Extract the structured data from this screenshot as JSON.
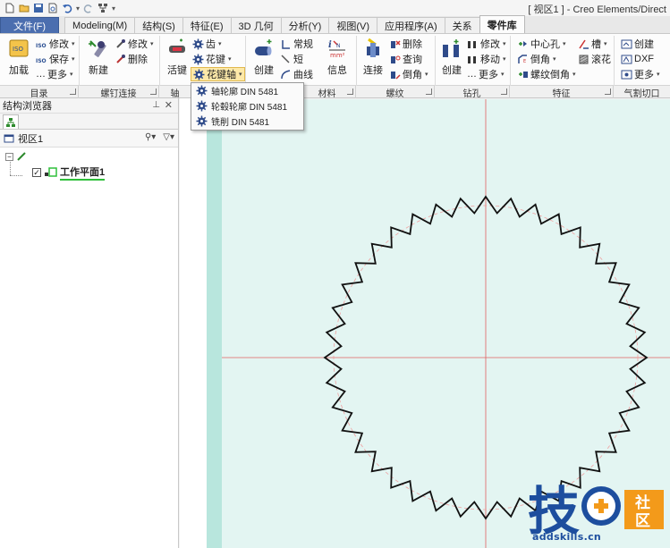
{
  "window": {
    "title": "[ 视区1 ] - Creo Elements/Direct"
  },
  "tabs": [
    {
      "label": "文件(F)"
    },
    {
      "label": "Modeling(M)"
    },
    {
      "label": "结构(S)"
    },
    {
      "label": "特征(E)"
    },
    {
      "label": "3D 几何"
    },
    {
      "label": "分析(Y)"
    },
    {
      "label": "视图(V)"
    },
    {
      "label": "应用程序(A)"
    },
    {
      "label": "关系"
    },
    {
      "label": "零件库"
    }
  ],
  "ribbon": {
    "catalog": {
      "load": "加载",
      "modify": "修改",
      "save": "保存",
      "more": "更多",
      "group": "目录"
    },
    "screw": {
      "new": "新建",
      "modify": "修改",
      "delete": "删除",
      "group": "螺钉连接"
    },
    "shaft": {
      "key": "活键",
      "gear": "齿",
      "spline": "花键",
      "spline_shaft": "花键轴",
      "group": "轴"
    },
    "material": {
      "create": "创建",
      "normal": "常规",
      "short": "短",
      "curve": "曲线",
      "info": "信息",
      "group": "材料"
    },
    "thread": {
      "connect": "连接",
      "delete": "删除",
      "query": "查询",
      "chamfer": "倒角",
      "group": "螺纹"
    },
    "drill": {
      "create": "创建",
      "modify": "修改",
      "move": "移动",
      "more": "更多",
      "group": "钻孔"
    },
    "feature": {
      "center_hole": "中心孔",
      "chamfer": "倒角",
      "thread_chamfer": "螺纹倒角",
      "slot": "槽",
      "knurl": "滚花",
      "group": "特征"
    },
    "cut": {
      "create": "创建",
      "dxf": "DXF",
      "more": "更多",
      "group": "气割切口"
    }
  },
  "dropdown": {
    "items": [
      {
        "label": "轴轮廓 DIN 5481"
      },
      {
        "label": "轮毂轮廓 DIN 5481"
      },
      {
        "label": "铣削 DIN 5481"
      }
    ]
  },
  "browser": {
    "title": "结构浏览器",
    "viewport_label": "视区1",
    "workplane": "工作平面1"
  },
  "watermark": {
    "big": "技",
    "small1": "社",
    "small2": "区",
    "domain": "addskills.cn"
  },
  "colors": {
    "file_tab": "#4b6eaf",
    "viewport_bg": "#e3f5f2",
    "axis_line": "#e06060",
    "watermark_blue": "#1d4e9e",
    "watermark_orange": "#f39a1a",
    "workplane_green": "#2fbf3a"
  }
}
